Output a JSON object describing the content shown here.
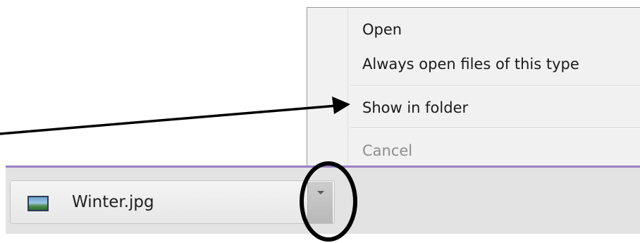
{
  "context_menu": {
    "items": [
      {
        "label": "Open",
        "enabled": true
      },
      {
        "label": "Always open files of this type",
        "enabled": true
      },
      {
        "label": "Show in folder",
        "enabled": true
      },
      {
        "label": "Cancel",
        "enabled": false
      }
    ]
  },
  "download_shelf": {
    "item": {
      "file_name": "Winter.jpg",
      "icon": "image-file-icon",
      "dropdown_icon": "caret-down-icon"
    },
    "accent_color": "#9b7fc4"
  },
  "annotations": {
    "arrow_target": "Show in folder",
    "circle_target": "dropdown-button",
    "color": "#000000"
  }
}
